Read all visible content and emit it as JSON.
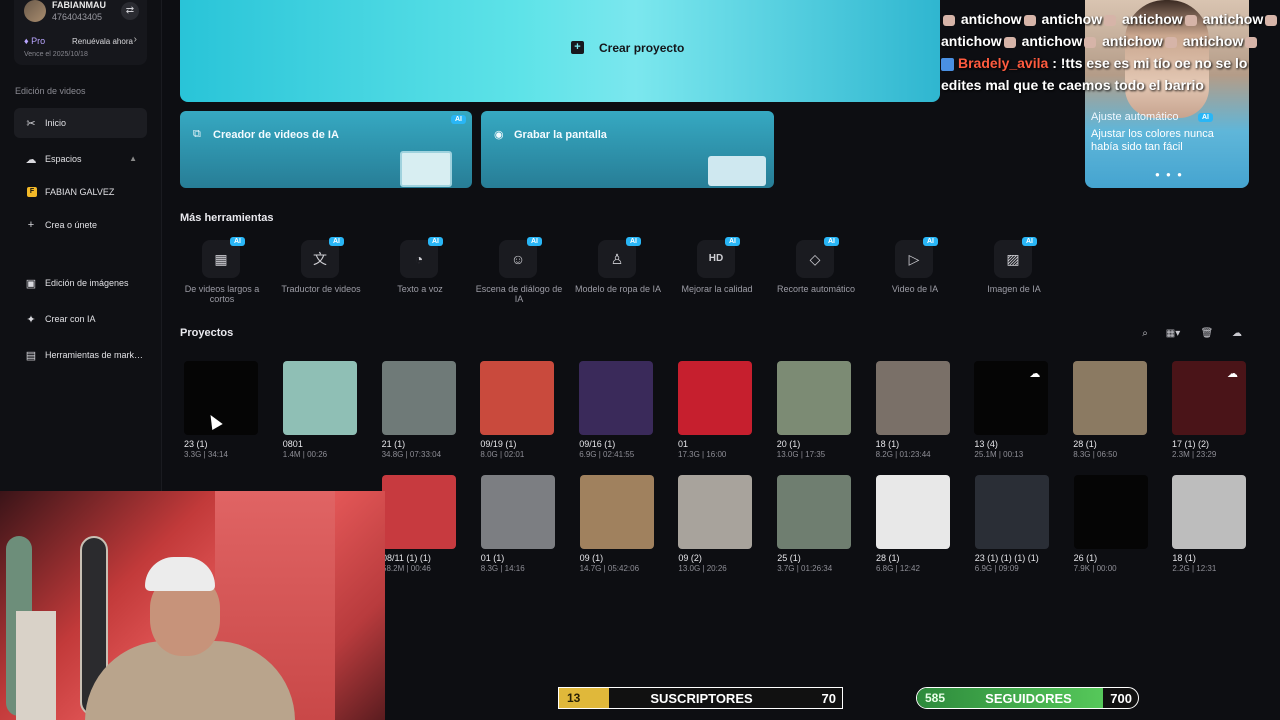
{
  "account": {
    "username": "FABIANMAU",
    "user_id": "4764043405",
    "plan": "Pro",
    "renew_label": "Renuévala ahora",
    "expiry": "Vence el 2025/10/18"
  },
  "sidebar": {
    "section_title": "Edición de videos",
    "items": [
      {
        "label": "Inicio",
        "icon": "scissors-icon"
      },
      {
        "label": "Espacios",
        "icon": "cloud-icon"
      },
      {
        "label": "FABIAN GALVEZ",
        "icon": "workspace-icon",
        "initial": "F"
      },
      {
        "label": "Crea o únete",
        "icon": "plus-icon"
      },
      {
        "label": "Edición de imágenes",
        "icon": "image-icon"
      },
      {
        "label": "Crear con IA",
        "icon": "sparkle-icon"
      },
      {
        "label": "Herramientas de mark…",
        "icon": "marketing-icon"
      }
    ]
  },
  "hero": {
    "label": "Crear proyecto"
  },
  "cards": [
    {
      "label": "Creador de videos de IA",
      "badge": "AI"
    },
    {
      "label": "Grabar la pantalla"
    }
  ],
  "promo": {
    "title": "Ajuste automático",
    "badge": "AI",
    "description": "Ajustar los colores nunca había sido tan fácil"
  },
  "chat": {
    "line1": "antichow",
    "user": "Bradely_avila",
    "message": ": !tts ese es mi tío oe no se lo edites mal que te caemos todo el barrio"
  },
  "tools_section": {
    "title": "Más herramientas",
    "badge": "AI",
    "items": [
      {
        "label": "De videos largos a cortos",
        "icon": "film-icon"
      },
      {
        "label": "Traductor de videos",
        "icon": "translate-icon"
      },
      {
        "label": "Texto a voz",
        "icon": "voice-icon"
      },
      {
        "label": "Escena de diálogo de IA",
        "icon": "dialog-icon"
      },
      {
        "label": "Modelo de ropa de IA",
        "icon": "shirt-icon"
      },
      {
        "label": "Mejorar la calidad",
        "icon": "hd-icon"
      },
      {
        "label": "Recorte automático",
        "icon": "eraser-icon"
      },
      {
        "label": "Video de IA",
        "icon": "play-icon"
      },
      {
        "label": "Imagen de IA",
        "icon": "image-ai-icon"
      }
    ]
  },
  "projects": {
    "title": "Proyectos",
    "row1": [
      {
        "name": "23 (1)",
        "meta": "3.3G | 34:14",
        "color": "#050505"
      },
      {
        "name": "0801",
        "meta": "1.4M | 00:26",
        "color": "#8fbfb5"
      },
      {
        "name": "21 (1)",
        "meta": "34.8G | 07:33:04",
        "color": "#6f7a78"
      },
      {
        "name": "09/19 (1)",
        "meta": "8.0G | 02:01",
        "color": "#c94a3d"
      },
      {
        "name": "09/16 (1)",
        "meta": "6.9G | 02:41:55",
        "color": "#3a2a5a"
      },
      {
        "name": "01",
        "meta": "17.3G | 16:00",
        "color": "#c61f2e"
      },
      {
        "name": "20 (1)",
        "meta": "13.0G | 17:35",
        "color": "#7c8b74"
      },
      {
        "name": "18 (1)",
        "meta": "8.2G | 01:23:44",
        "color": "#7a7068"
      },
      {
        "name": "13 (4)",
        "meta": "25.1M | 00:13",
        "color": "#050505",
        "cloud": true
      },
      {
        "name": "28 (1)",
        "meta": "8.3G | 06:50",
        "color": "#8b7a62"
      },
      {
        "name": "17 (1) (2)",
        "meta": "2.3M | 23:29",
        "color": "#4a1418",
        "cloud": true
      }
    ],
    "row2": [
      {
        "name": "08/11 (1) (1)",
        "meta": "58.2M | 00:46",
        "color": "#c73a3f"
      },
      {
        "name": "01 (1)",
        "meta": "8.3G | 14:16",
        "color": "#7c7e82"
      },
      {
        "name": "09 (1)",
        "meta": "14.7G | 05:42:06",
        "color": "#a0815e"
      },
      {
        "name": "09 (2)",
        "meta": "13.0G | 20:26",
        "color": "#a8a39c"
      },
      {
        "name": "25 (1)",
        "meta": "3.7G | 01:26:34",
        "color": "#6f7e70"
      },
      {
        "name": "28 (1)",
        "meta": "6.8G | 12:42",
        "color": "#e8e8e8"
      },
      {
        "name": "23 (1) (1) (1) (1)",
        "meta": "6.9G | 09:09",
        "color": "#2a2e36"
      },
      {
        "name": "26 (1)",
        "meta": "7.9K | 00:00",
        "color": "#050505"
      },
      {
        "name": "18 (1)",
        "meta": "2.2G | 12:31",
        "color": "#bdbdbd"
      }
    ]
  },
  "counters": {
    "subs": {
      "current": "13",
      "label": "SUSCRIPTORES",
      "goal": "70"
    },
    "followers": {
      "current": "585",
      "label": "SEGUIDORES",
      "goal": "700"
    }
  }
}
